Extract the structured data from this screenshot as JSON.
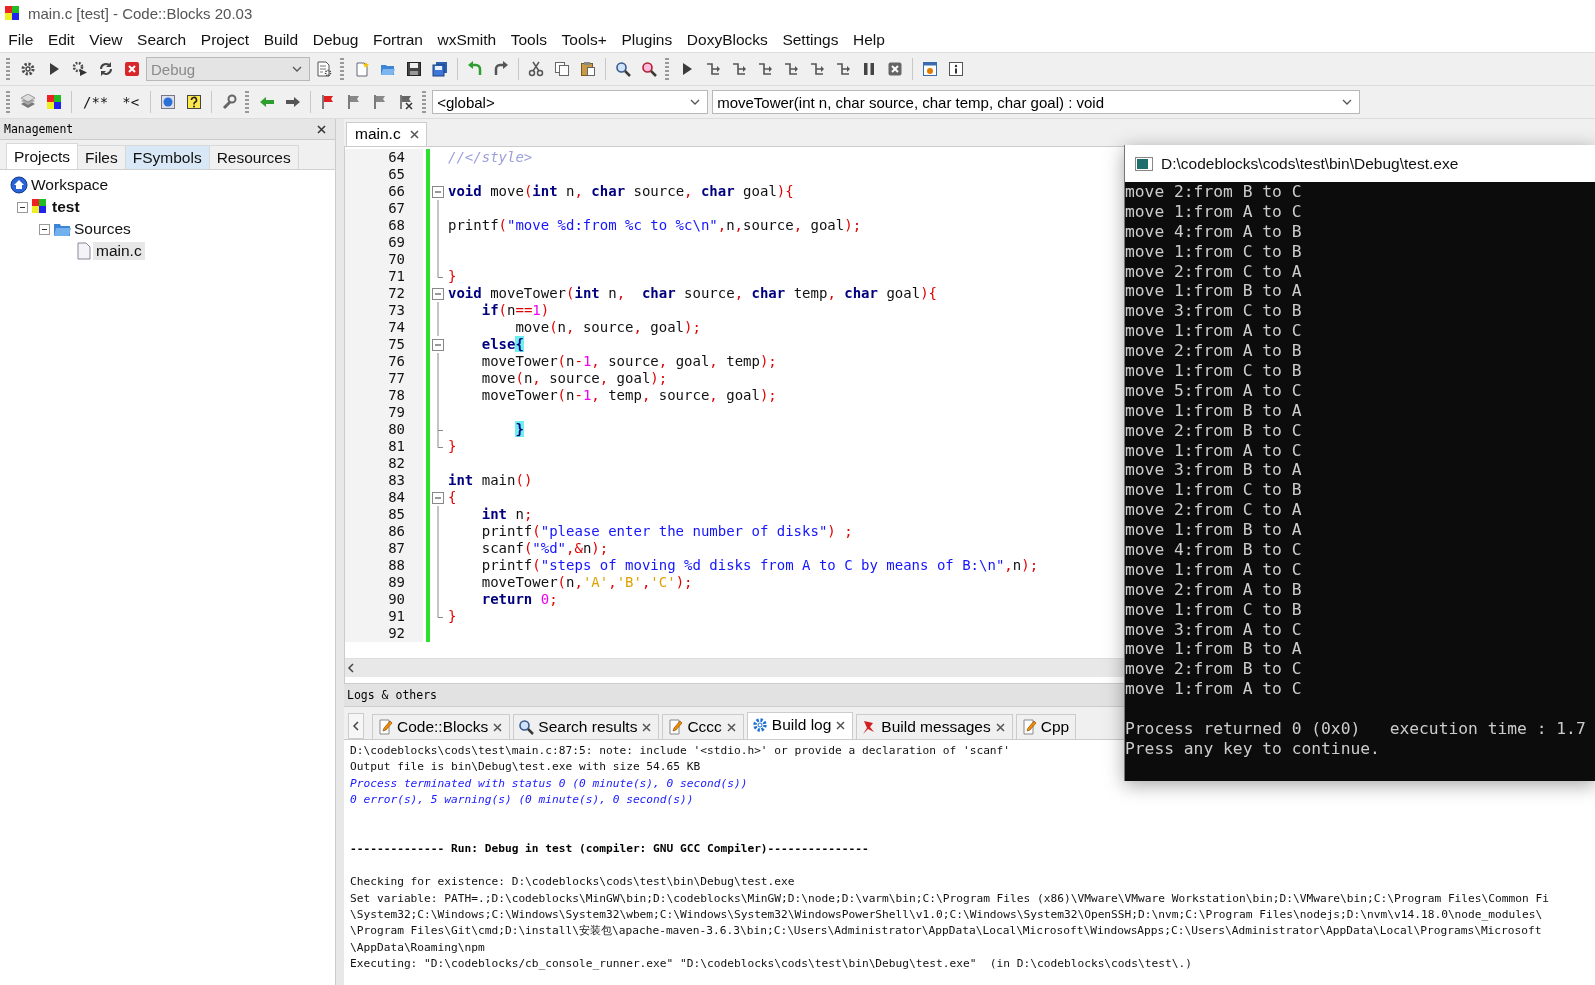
{
  "window": {
    "title": "main.c [test] - Code::Blocks 20.03"
  },
  "menu": [
    "File",
    "Edit",
    "View",
    "Search",
    "Project",
    "Build",
    "Debug",
    "Fortran",
    "wxSmith",
    "Tools",
    "Tools+",
    "Plugins",
    "DoxyBlocks",
    "Settings",
    "Help"
  ],
  "toolbar": {
    "build_target": "Debug",
    "comment_buttons": [
      "/**",
      "*<"
    ],
    "scope": "<global>",
    "function": "moveTower(int n, char source, char temp, char goal) : void"
  },
  "management": {
    "title": "Management",
    "tabs": [
      {
        "label": "Projects",
        "selected": true,
        "hovered": false
      },
      {
        "label": "Files",
        "selected": false,
        "hovered": false
      },
      {
        "label": "FSymbols",
        "selected": false,
        "hovered": true
      },
      {
        "label": "Resources",
        "selected": false,
        "hovered": false
      }
    ],
    "tree": [
      {
        "label": "Workspace",
        "kind": "workspace",
        "selected": false,
        "children": [
          {
            "label": "test",
            "kind": "project",
            "selected": false,
            "expanded": true,
            "children": [
              {
                "label": "Sources",
                "kind": "folder",
                "selected": false,
                "expanded": true,
                "children": [
                  {
                    "label": "main.c",
                    "kind": "file",
                    "selected": true
                  }
                ]
              }
            ]
          }
        ]
      }
    ]
  },
  "editor": {
    "tabs": [
      {
        "label": "main.c",
        "selected": true
      }
    ],
    "lines": [
      {
        "number": "64",
        "kind": "plain",
        "tokens": [
          {
            "kind": "comment",
            "text": "//</style>"
          }
        ]
      },
      {
        "number": "65",
        "kind": "plain"
      },
      {
        "number": "66",
        "kind": "fold_start",
        "tokens": [
          {
            "kind": "kw",
            "text": "void"
          },
          {
            "kind": "text",
            "text": " move"
          },
          {
            "kind": "op",
            "text": "("
          },
          {
            "kind": "kw",
            "text": "int"
          },
          {
            "kind": "text",
            "text": " n"
          },
          {
            "kind": "op",
            "text": ", "
          },
          {
            "kind": "kw",
            "text": "char"
          },
          {
            "kind": "text",
            "text": " source"
          },
          {
            "kind": "op",
            "text": ", "
          },
          {
            "kind": "kw",
            "text": "char"
          },
          {
            "kind": "text",
            "text": " goal"
          },
          {
            "kind": "op",
            "text": "){"
          }
        ]
      },
      {
        "number": "67",
        "kind": "fold_body"
      },
      {
        "number": "68",
        "kind": "fold_body",
        "tokens": [
          {
            "kind": "text",
            "text": "printf"
          },
          {
            "kind": "op",
            "text": "("
          },
          {
            "kind": "str",
            "text": "\"move %d:from %c to %c\\n\""
          },
          {
            "kind": "op",
            "text": ","
          },
          {
            "kind": "text",
            "text": "n"
          },
          {
            "kind": "op",
            "text": ","
          },
          {
            "kind": "text",
            "text": "source"
          },
          {
            "kind": "op",
            "text": ", "
          },
          {
            "kind": "text",
            "text": "goal"
          },
          {
            "kind": "op",
            "text": ");"
          }
        ]
      },
      {
        "number": "69",
        "kind": "fold_body"
      },
      {
        "number": "70",
        "kind": "fold_body"
      },
      {
        "number": "71",
        "kind": "fold_end",
        "tokens": [
          {
            "kind": "op",
            "text": "}"
          }
        ]
      },
      {
        "number": "72",
        "kind": "fold_start",
        "tokens": [
          {
            "kind": "kw",
            "text": "void"
          },
          {
            "kind": "text",
            "text": " moveTower"
          },
          {
            "kind": "op",
            "text": "("
          },
          {
            "kind": "kw",
            "text": "int"
          },
          {
            "kind": "text",
            "text": " n"
          },
          {
            "kind": "op",
            "text": ",  "
          },
          {
            "kind": "kw",
            "text": "char"
          },
          {
            "kind": "text",
            "text": " source"
          },
          {
            "kind": "op",
            "text": ", "
          },
          {
            "kind": "kw",
            "text": "char"
          },
          {
            "kind": "text",
            "text": " temp"
          },
          {
            "kind": "op",
            "text": ", "
          },
          {
            "kind": "kw",
            "text": "char"
          },
          {
            "kind": "text",
            "text": " goal"
          },
          {
            "kind": "op",
            "text": "){"
          }
        ]
      },
      {
        "number": "73",
        "kind": "fold_body",
        "tokens": [
          {
            "kind": "kw",
            "text": "    if"
          },
          {
            "kind": "op",
            "text": "("
          },
          {
            "kind": "text",
            "text": "n"
          },
          {
            "kind": "op",
            "text": "=="
          },
          {
            "kind": "num",
            "text": "1"
          },
          {
            "kind": "op",
            "text": ")"
          }
        ]
      },
      {
        "number": "74",
        "kind": "fold_body",
        "tokens": [
          {
            "kind": "text",
            "text": "        move"
          },
          {
            "kind": "op",
            "text": "("
          },
          {
            "kind": "text",
            "text": "n"
          },
          {
            "kind": "op",
            "text": ", "
          },
          {
            "kind": "text",
            "text": "source"
          },
          {
            "kind": "op",
            "text": ", "
          },
          {
            "kind": "text",
            "text": "goal"
          },
          {
            "kind": "op",
            "text": ");"
          }
        ]
      },
      {
        "number": "75",
        "kind": "fold_start",
        "tokens": [
          {
            "kind": "kw",
            "text": "    else"
          },
          {
            "kind": "match",
            "text": "{"
          }
        ]
      },
      {
        "number": "76",
        "kind": "fold_body",
        "tokens": [
          {
            "kind": "text",
            "text": "    moveTower"
          },
          {
            "kind": "op",
            "text": "("
          },
          {
            "kind": "text",
            "text": "n"
          },
          {
            "kind": "op",
            "text": "-"
          },
          {
            "kind": "num",
            "text": "1"
          },
          {
            "kind": "op",
            "text": ", "
          },
          {
            "kind": "text",
            "text": "source"
          },
          {
            "kind": "op",
            "text": ", "
          },
          {
            "kind": "text",
            "text": "goal"
          },
          {
            "kind": "op",
            "text": ", "
          },
          {
            "kind": "text",
            "text": "temp"
          },
          {
            "kind": "op",
            "text": ");"
          }
        ]
      },
      {
        "number": "77",
        "kind": "fold_body",
        "tokens": [
          {
            "kind": "text",
            "text": "    move"
          },
          {
            "kind": "op",
            "text": "("
          },
          {
            "kind": "text",
            "text": "n"
          },
          {
            "kind": "op",
            "text": ", "
          },
          {
            "kind": "text",
            "text": "source"
          },
          {
            "kind": "op",
            "text": ", "
          },
          {
            "kind": "text",
            "text": "goal"
          },
          {
            "kind": "op",
            "text": ");"
          }
        ]
      },
      {
        "number": "78",
        "kind": "fold_body",
        "tokens": [
          {
            "kind": "text",
            "text": "    moveTower"
          },
          {
            "kind": "op",
            "text": "("
          },
          {
            "kind": "text",
            "text": "n"
          },
          {
            "kind": "op",
            "text": "-"
          },
          {
            "kind": "num",
            "text": "1"
          },
          {
            "kind": "op",
            "text": ", "
          },
          {
            "kind": "text",
            "text": "temp"
          },
          {
            "kind": "op",
            "text": ", "
          },
          {
            "kind": "text",
            "text": "source"
          },
          {
            "kind": "op",
            "text": ", "
          },
          {
            "kind": "text",
            "text": "goal"
          },
          {
            "kind": "op",
            "text": ");"
          }
        ]
      },
      {
        "number": "79",
        "kind": "fold_body"
      },
      {
        "number": "80",
        "kind": "fold_branch",
        "tokens": [
          {
            "kind": "match",
            "text": "        }"
          }
        ]
      },
      {
        "number": "81",
        "kind": "fold_end",
        "tokens": [
          {
            "kind": "op",
            "text": "}"
          }
        ]
      },
      {
        "number": "82",
        "kind": "plain"
      },
      {
        "number": "83",
        "kind": "plain",
        "tokens": [
          {
            "kind": "kw",
            "text": "int"
          },
          {
            "kind": "text",
            "text": " main"
          },
          {
            "kind": "op",
            "text": "()"
          }
        ]
      },
      {
        "number": "84",
        "kind": "fold_start",
        "tokens": [
          {
            "kind": "op",
            "text": "{"
          }
        ]
      },
      {
        "number": "85",
        "kind": "fold_body",
        "tokens": [
          {
            "kind": "kw",
            "text": "    int"
          },
          {
            "kind": "text",
            "text": " n"
          },
          {
            "kind": "op",
            "text": ";"
          }
        ]
      },
      {
        "number": "86",
        "kind": "fold_body",
        "tokens": [
          {
            "kind": "text",
            "text": "    printf"
          },
          {
            "kind": "op",
            "text": "("
          },
          {
            "kind": "str",
            "text": "\"please enter the number of disks\""
          },
          {
            "kind": "op",
            "text": ") ;"
          }
        ]
      },
      {
        "number": "87",
        "kind": "fold_body",
        "tokens": [
          {
            "kind": "text",
            "text": "    scanf"
          },
          {
            "kind": "op",
            "text": "("
          },
          {
            "kind": "str",
            "text": "\"%d\""
          },
          {
            "kind": "op",
            "text": ",&"
          },
          {
            "kind": "text",
            "text": "n"
          },
          {
            "kind": "op",
            "text": ");"
          }
        ]
      },
      {
        "number": "88",
        "kind": "fold_body",
        "tokens": [
          {
            "kind": "text",
            "text": "    printf"
          },
          {
            "kind": "op",
            "text": "("
          },
          {
            "kind": "str",
            "text": "\"steps of moving %d disks from A to C by means of B:\\n\""
          },
          {
            "kind": "op",
            "text": ","
          },
          {
            "kind": "text",
            "text": "n"
          },
          {
            "kind": "op",
            "text": ");"
          }
        ]
      },
      {
        "number": "89",
        "kind": "fold_body",
        "tokens": [
          {
            "kind": "text",
            "text": "    moveTower"
          },
          {
            "kind": "op",
            "text": "("
          },
          {
            "kind": "text",
            "text": "n"
          },
          {
            "kind": "op",
            "text": ","
          },
          {
            "kind": "chr",
            "text": "'A'"
          },
          {
            "kind": "op",
            "text": ","
          },
          {
            "kind": "chr",
            "text": "'B'"
          },
          {
            "kind": "op",
            "text": ","
          },
          {
            "kind": "chr",
            "text": "'C'"
          },
          {
            "kind": "op",
            "text": ");"
          }
        ]
      },
      {
        "number": "90",
        "kind": "fold_body",
        "tokens": [
          {
            "kind": "kw",
            "text": "    return"
          },
          {
            "kind": "num",
            "text": " 0"
          },
          {
            "kind": "op",
            "text": ";"
          }
        ]
      },
      {
        "number": "91",
        "kind": "fold_end",
        "tokens": [
          {
            "kind": "op",
            "text": "}"
          }
        ]
      },
      {
        "number": "92",
        "kind": "plain"
      }
    ]
  },
  "logs": {
    "title": "Logs & others",
    "tabs": [
      {
        "label": "Code::Blocks",
        "selected": false
      },
      {
        "label": "Search results",
        "selected": false
      },
      {
        "label": "Cccc",
        "selected": false
      },
      {
        "label": "Build log",
        "selected": true
      },
      {
        "label": "Build messages",
        "selected": false
      },
      {
        "label": "Cpp",
        "selected": false
      }
    ],
    "lines": [
      {
        "kind": "normal",
        "text": "D:\\codeblocks\\cods\\test\\main.c:87:5: note: include '<stdio.h>' or provide a declaration of 'scanf'"
      },
      {
        "kind": "normal",
        "text": "Output file is bin\\Debug\\test.exe with size 54.65 KB"
      },
      {
        "kind": "info",
        "text": "Process terminated with status 0 (0 minute(s), 0 second(s))"
      },
      {
        "kind": "info",
        "text": "0 error(s), 5 warning(s) (0 minute(s), 0 second(s))"
      },
      {
        "kind": "blank"
      },
      {
        "kind": "blank"
      },
      {
        "kind": "heading",
        "text": "-------------- Run: Debug in test (compiler: GNU GCC Compiler)---------------"
      },
      {
        "kind": "blank"
      },
      {
        "kind": "normal",
        "text": "Checking for existence: D:\\codeblocks\\cods\\test\\bin\\Debug\\test.exe"
      },
      {
        "kind": "normal",
        "text": "Set variable: PATH=.;D:\\codeblocks\\MinGW\\bin;D:\\codeblocks\\MinGW;D:\\node;D:\\varm\\bin;C:\\Program Files (x86)\\VMware\\VMware Workstation\\bin;D:\\VMware\\bin;C:\\Program Files\\Common Fi"
      },
      {
        "kind": "normal",
        "text": "\\System32;C:\\Windows;C:\\Windows\\System32\\wbem;C:\\Windows\\System32\\WindowsPowerShell\\v1.0;C:\\Windows\\System32\\OpenSSH;D:\\nvm;C:\\Program Files\\nodejs;D:\\nvm\\v14.18.0\\node_modules\\"
      },
      {
        "kind": "normal",
        "text": "\\Program Files\\Git\\cmd;D:\\install\\安装包\\apache-maven-3.6.3\\bin;C:\\Users\\Administrator\\AppData\\Local\\Microsoft\\WindowsApps;C:\\Users\\Administrator\\AppData\\Local\\Programs\\Microsoft"
      },
      {
        "kind": "normal",
        "text": "\\AppData\\Roaming\\npm"
      },
      {
        "kind": "normal",
        "text": "Executing: \"D:\\codeblocks/cb_console_runner.exe\" \"D:\\codeblocks\\cods\\test\\bin\\Debug\\test.exe\"  (in D:\\codeblocks\\cods\\test\\.)"
      }
    ]
  },
  "console": {
    "title": "D:\\codeblocks\\cods\\test\\bin\\Debug\\test.exe",
    "lines": [
      "move 2:from B to C",
      "move 1:from A to C",
      "move 4:from A to B",
      "move 1:from C to B",
      "move 2:from C to A",
      "move 1:from B to A",
      "move 3:from C to B",
      "move 1:from A to C",
      "move 2:from A to B",
      "move 1:from C to B",
      "move 5:from A to C",
      "move 1:from B to A",
      "move 2:from B to C",
      "move 1:from A to C",
      "move 3:from B to A",
      "move 1:from C to B",
      "move 2:from C to A",
      "move 1:from B to A",
      "move 4:from B to C",
      "move 1:from A to C",
      "move 2:from A to B",
      "move 1:from C to B",
      "move 3:from A to C",
      "move 1:from B to A",
      "move 2:from B to C",
      "move 1:from A to C"
    ],
    "footer": [
      "Process returned 0 (0x0)   execution time : 1.7",
      "Press any key to continue."
    ]
  }
}
